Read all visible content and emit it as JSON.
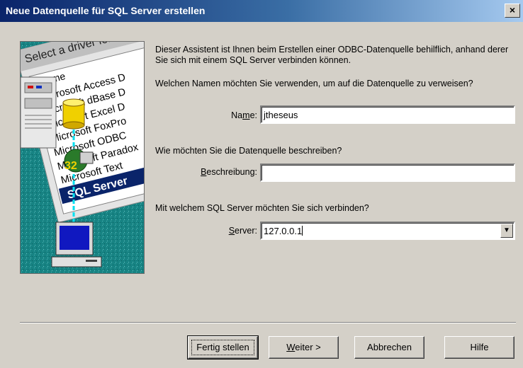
{
  "window": {
    "title": "Neue Datenquelle für SQL Server erstellen",
    "close_glyph": "×"
  },
  "illustration": {
    "header": "Select a driver for",
    "column": "Name",
    "drivers": [
      "Microsoft Access D",
      "Microsoft dBase D",
      "Microsoft Excel D",
      "Microsoft FoxPro",
      "Microsoft ODBC",
      "Microsoft Paradox",
      "Microsoft Text"
    ],
    "selected": "SQL Server",
    "badge": "32",
    "icons": [
      "server-icon",
      "database-icon",
      "network-globe-icon",
      "computer-icon"
    ]
  },
  "intro": "Dieser Assistent ist Ihnen beim Erstellen einer ODBC-Datenquelle behilflich, anhand derer Sie sich mit einem SQL Server verbinden können.",
  "name_section": {
    "question": "Welchen Namen möchten Sie verwenden, um auf die Datenquelle zu verweisen?",
    "label_pre": "Na",
    "label_key": "m",
    "label_post": "e:",
    "value": "jtheseus"
  },
  "desc_section": {
    "question": "Wie möchten Sie die Datenquelle beschreiben?",
    "label_key": "B",
    "label_post": "eschreibung:",
    "value": ""
  },
  "server_section": {
    "question": "Mit welchem SQL Server möchten Sie sich verbinden?",
    "label_key": "S",
    "label_post": "erver:",
    "value": "127.0.0.1",
    "dropdown_glyph": "▼"
  },
  "buttons": {
    "finish": "Fertig stellen",
    "next_key": "W",
    "next_post": "eiter >",
    "cancel": "Abbrechen",
    "help": "Hilfe"
  }
}
